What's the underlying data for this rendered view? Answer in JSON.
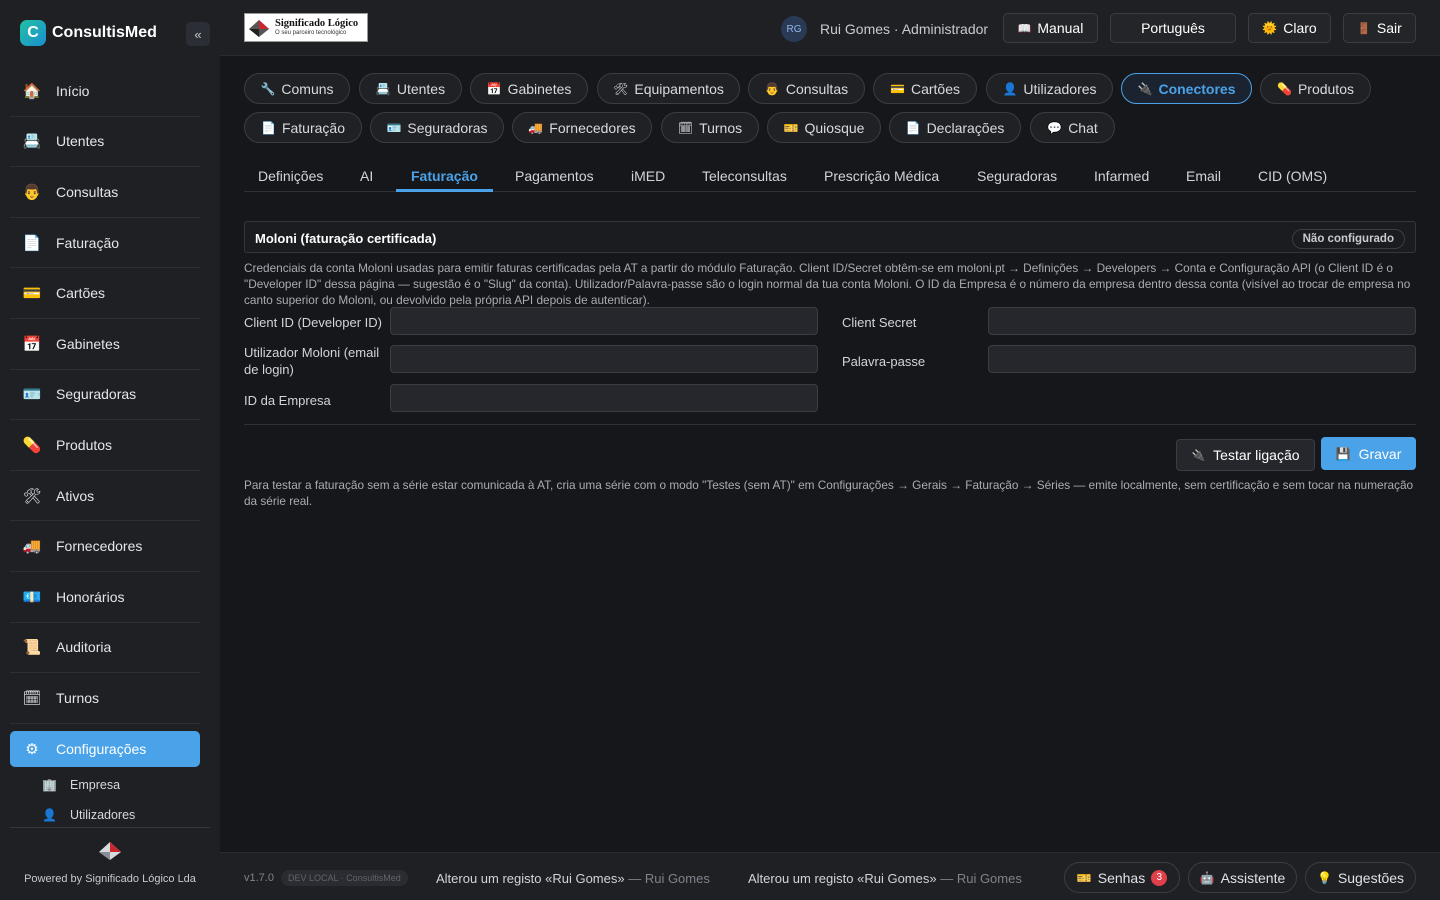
{
  "app": {
    "name": "ConsultisMed",
    "logo_letter": "C",
    "collapse_glyph": "«"
  },
  "sidebar": {
    "items": [
      {
        "label": "Início",
        "icon": "🏠",
        "icon_name": "home-icon"
      },
      {
        "label": "Utentes",
        "icon": "📇",
        "icon_name": "patients-icon"
      },
      {
        "label": "Consultas",
        "icon": "👨",
        "icon_name": "doctor-icon"
      },
      {
        "label": "Faturação",
        "icon": "📄",
        "icon_name": "invoice-icon"
      },
      {
        "label": "Cartões",
        "icon": "💳",
        "icon_name": "card-icon"
      },
      {
        "label": "Gabinetes",
        "icon": "📅",
        "icon_name": "calendar-icon"
      },
      {
        "label": "Seguradoras",
        "icon": "🪪",
        "icon_name": "insurance-icon"
      },
      {
        "label": "Produtos",
        "icon": "💊",
        "icon_name": "pill-icon"
      },
      {
        "label": "Ativos",
        "icon": "🛠",
        "icon_name": "tools-icon"
      },
      {
        "label": "Fornecedores",
        "icon": "🚚",
        "icon_name": "truck-icon"
      },
      {
        "label": "Honorários",
        "icon": "💶",
        "icon_name": "money-icon"
      },
      {
        "label": "Auditoria",
        "icon": "📜",
        "icon_name": "scroll-icon"
      },
      {
        "label": "Turnos",
        "icon": "🗓",
        "icon_name": "shifts-icon"
      }
    ],
    "active_item": {
      "label": "Configurações",
      "icon": "⚙",
      "icon_name": "gear-icon"
    },
    "sub_items": [
      {
        "label": "Empresa",
        "icon": "🏢"
      },
      {
        "label": "Utilizadores",
        "icon": "👤"
      }
    ],
    "powered_by": "Powered by Significado Lógico Lda"
  },
  "header": {
    "company_logo_line1": "Significado Lógico",
    "company_logo_line2": "O seu parceiro tecnológico",
    "user_initials": "RG",
    "user_label": "Rui Gomes · Administrador",
    "manual_label": "Manual",
    "manual_icon": "📖",
    "language_label": "Português",
    "theme_label": "Claro",
    "theme_icon": "🌞",
    "logout_label": "Sair",
    "logout_icon": "🚪"
  },
  "sections": [
    {
      "label": "Comuns",
      "icon": "🔧"
    },
    {
      "label": "Utentes",
      "icon": "📇"
    },
    {
      "label": "Gabinetes",
      "icon": "📅"
    },
    {
      "label": "Equipamentos",
      "icon": "🛠"
    },
    {
      "label": "Consultas",
      "icon": "👨"
    },
    {
      "label": "Cartões",
      "icon": "💳"
    },
    {
      "label": "Utilizadores",
      "icon": "👤"
    },
    {
      "label": "Conectores",
      "icon": "🔌",
      "active": true
    },
    {
      "label": "Produtos",
      "icon": "💊"
    },
    {
      "label": "Faturação",
      "icon": "📄"
    },
    {
      "label": "Seguradoras",
      "icon": "🪪"
    },
    {
      "label": "Fornecedores",
      "icon": "🚚"
    },
    {
      "label": "Turnos",
      "icon": "🗓"
    },
    {
      "label": "Quiosque",
      "icon": "🎫"
    },
    {
      "label": "Declarações",
      "icon": "📄"
    },
    {
      "label": "Chat",
      "icon": "💬"
    }
  ],
  "tabs": [
    "Definições",
    "AI",
    "Faturação",
    "Pagamentos",
    "iMED",
    "Teleconsultas",
    "Prescrição Médica",
    "Seguradoras",
    "Infarmed",
    "Email",
    "CID (OMS)"
  ],
  "active_tab": "Faturação",
  "card": {
    "title": "Moloni (faturação certificada)",
    "status": "Não configurado",
    "description": "Credenciais da conta Moloni usadas para emitir faturas certificadas pela AT a partir do módulo Faturação. Client ID/Secret obtêm-se em moloni.pt → Definições → Developers → Conta e Configuração API (o Client ID é o \"Developer ID\" dessa página — sugestão é o \"Slug\" da conta). Utilizador/Palavra-passe são o login normal da tua conta Moloni. O ID da Empresa é o número da empresa dentro dessa conta (visível ao trocar de empresa no canto superior do Moloni, ou devolvido pela própria API depois de autenticar).",
    "fields": {
      "client_id": {
        "label": "Client ID (Developer ID)",
        "value": ""
      },
      "client_secret": {
        "label": "Client Secret",
        "value": ""
      },
      "username": {
        "label": "Utilizador Moloni (email de login)",
        "value": ""
      },
      "password": {
        "label": "Palavra-passe",
        "value": ""
      },
      "company_id": {
        "label": "ID da Empresa",
        "value": ""
      }
    },
    "test_label": "Testar ligação",
    "test_icon": "🔌",
    "save_label": "Gravar",
    "save_icon": "💾",
    "note": "Para testar a faturação sem a série estar comunicada à AT, cria uma série com o modo \"Testes (sem AT)\" em Configurações → Gerais → Faturação → Séries — emite localmente, sem certificação e sem tocar na numeração da série real."
  },
  "footer": {
    "version": "v1.7.0",
    "env": "DEV LOCAL · ConsultisMed",
    "log1_text": "Alterou um registo «Rui Gomes»",
    "log1_who": "— Rui Gomes",
    "log2_text": "Alterou um registo «Rui Gomes»",
    "log2_who": "— Rui Gomes",
    "senhas_label": "Senhas",
    "senhas_icon": "🎫",
    "senhas_count": "3",
    "assistente_label": "Assistente",
    "assistente_icon": "🤖",
    "sugestoes_label": "Sugestões",
    "sugestoes_icon": "💡"
  },
  "colors": {
    "accent": "#4aa3e8",
    "background": "#16171b",
    "panel": "#1e2024",
    "danger": "#e0404a"
  }
}
